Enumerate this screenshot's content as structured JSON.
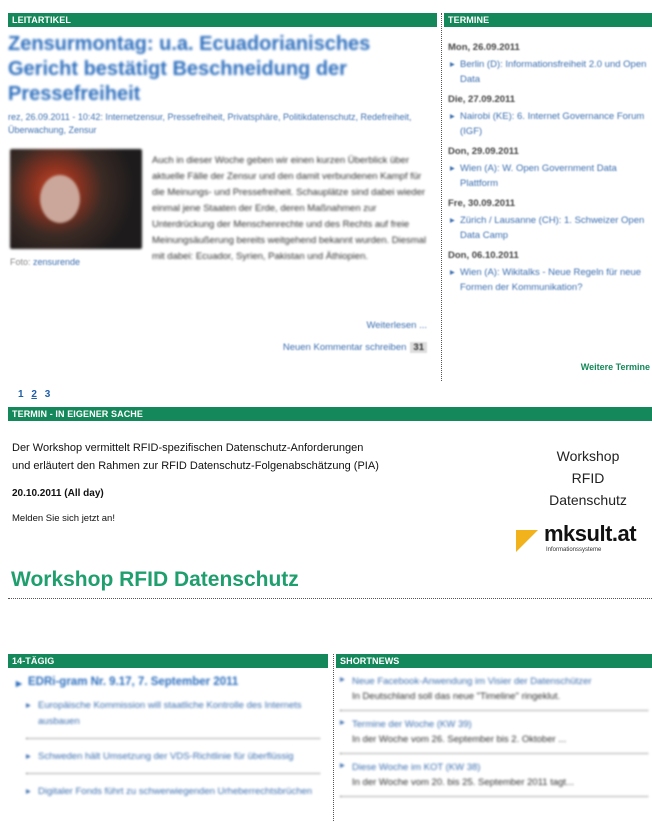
{
  "leitartikel": {
    "header": "LEITARTIKEL",
    "headline": "Zensurmontag: u.a. Ecuadorianisches Gericht bestätigt Beschneidung der Pressefreiheit",
    "meta": "rez, 26.09.2011 - 10:42: Internetzensur, Pressefreiheit, Privatsphäre, Politikdatenschutz, Redefreiheit, Überwachung, Zensur",
    "caption_prefix": "Foto:",
    "caption_link": "zensurende",
    "body": "Auch in dieser Woche geben wir einen kurzen Überblick über aktuelle Fälle der Zensur und den damit verbundenen Kampf für die Meinungs- und Pressefreiheit. Schauplätze sind dabei wieder einmal jene Staaten der Erde, deren Maßnahmen zur Unterdrückung der Menschenrechte und des Rechts auf freie Meinungsäußerung bereits weitgehend bekannt wurden. Diesmal mit dabei: Ecuador, Syrien, Pakistan und Äthiopien.",
    "more": "Weiterlesen ...",
    "comment": "Neuen Kommentar schreiben",
    "comment_count": "31"
  },
  "termine": {
    "header": "TERMINE",
    "days": [
      {
        "day": "Mon, 26.09.2011",
        "event": "Berlin (D): Informationsfreiheit 2.0 und Open Data"
      },
      {
        "day": "Die, 27.09.2011",
        "event": "Nairobi (KE): 6. Internet Governance Forum (IGF)"
      },
      {
        "day": "Don, 29.09.2011",
        "event": "Wien (A): W. Open Government Data Plattform"
      },
      {
        "day": "Fre, 30.09.2011",
        "event": "Zürich / Lausanne (CH): 1. Schweizer Open Data Camp"
      },
      {
        "day": "Don, 06.10.2011",
        "event": "Wien (A): Wikitalks - Neue Regeln für neue Formen der Kommunikation?"
      }
    ],
    "more": "Weitere Termine"
  },
  "pager": {
    "pages": [
      "1",
      "2",
      "3"
    ],
    "current": "2"
  },
  "eigene_sache": {
    "header": "TERMIN - IN EIGENER SACHE",
    "text_line1": "Der Workshop vermittelt RFID-spezifischen Datenschutz-Anforderungen",
    "text_line2": "und erläutert den Rahmen zur RFID Datenschutz-Folgenabschätzung (PIA)",
    "date": "20.10.2011 (All day)",
    "signup": "Melden Sie sich jetzt an!",
    "ws_line1": "Workshop",
    "ws_line2": "RFID",
    "ws_line3": "Datenschutz",
    "logo_name": "mksult.at",
    "logo_sub": "Informationssysteme",
    "logo_color": "#f2b21b"
  },
  "workshop_title": "Workshop RFID Datenschutz",
  "vierzehntaegig": {
    "header": "14-TÄGIG",
    "main": "EDRi-gram Nr. 9.17, 7. September 2011",
    "items": [
      "Europäische Kommission will staatliche Kontrolle des Internets ausbauen",
      "Schweden hält Umsetzung der VDS-Richtlinie für überflüssig",
      "Digitaler Fonds führt zu schwerwiegenden Urheberrechtsbrüchen"
    ]
  },
  "shortnews": {
    "header": "SHORTNEWS",
    "items": [
      {
        "title": "Neue Facebook-Anwendung im Visier der Datenschützer",
        "desc": "In Deutschland soll das neue \"Timeline\" ringeklut."
      },
      {
        "title": "Termine der Woche (KW 39)",
        "desc": "In der Woche vom 26. September bis 2. Oktober ..."
      },
      {
        "title": "Diese Woche im KOT (KW 38)",
        "desc": "In der Woche vom 20. bis 25. September 2011 tagt..."
      }
    ]
  },
  "colors": {
    "accent": "#14885a",
    "link": "#1f5fa8",
    "title_green": "#1f9e6e"
  }
}
